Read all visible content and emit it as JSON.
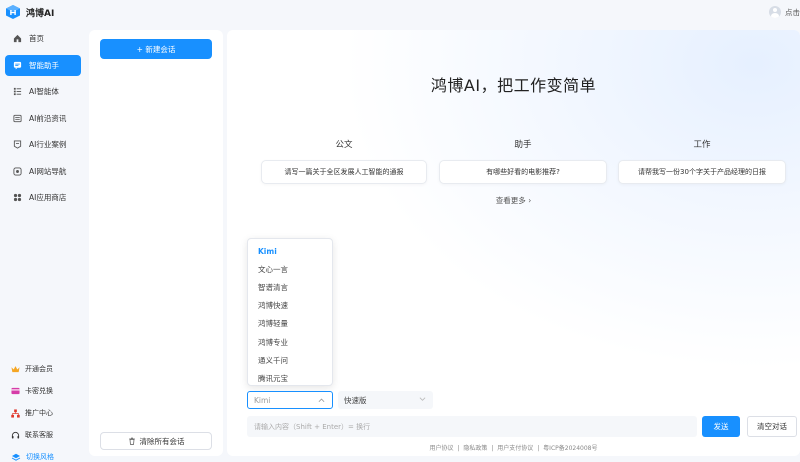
{
  "logo": {
    "text": "鸿博AI"
  },
  "user": {
    "label": "点击"
  },
  "nav": {
    "items": [
      {
        "label": "首页",
        "icon": "home-icon"
      },
      {
        "label": "智能助手",
        "icon": "chat-icon",
        "active": true
      },
      {
        "label": "AI智能体",
        "icon": "list-icon"
      },
      {
        "label": "AI前沿资讯",
        "icon": "news-icon"
      },
      {
        "label": "AI行业案例",
        "icon": "case-icon"
      },
      {
        "label": "AI网站导航",
        "icon": "compass-icon"
      },
      {
        "label": "AI应用商店",
        "icon": "apps-icon"
      }
    ]
  },
  "bottom": {
    "items": [
      {
        "label": "开通会员"
      },
      {
        "label": "卡密兑换"
      },
      {
        "label": "推广中心"
      },
      {
        "label": "联系客服"
      },
      {
        "label": "切换风格"
      }
    ]
  },
  "conversations": {
    "new_label": "+ 新建会话",
    "clear_label": "清除所有会话"
  },
  "main": {
    "headline": "鸿博AI，把工作变简单",
    "categories": [
      {
        "label": "公文",
        "prompt": "请写一篇关于全区发展人工智能的通报"
      },
      {
        "label": "助手",
        "prompt": "有哪些好看的电影推荐?"
      },
      {
        "label": "工作",
        "prompt": "请帮我写一份30个字关于产品经理的日报"
      }
    ],
    "more_label": "查看更多",
    "models": [
      "Kimi",
      "文心一言",
      "智谱清言",
      "鸿博快速",
      "鸿博轻量",
      "鸿博专业",
      "通义千问",
      "腾讯元宝"
    ],
    "model_selected": "Kimi",
    "version_selected": "快速版",
    "input_placeholder": "请输入内容（Shift + Enter）= 换行",
    "send_label": "发送",
    "clear_chat_label": "清空对话",
    "footer": {
      "links": [
        "用户协议",
        "隐私政策",
        "用户支付协议"
      ],
      "icp": "粤ICP备2024008号"
    }
  },
  "colors": {
    "accent": "#1890ff"
  }
}
